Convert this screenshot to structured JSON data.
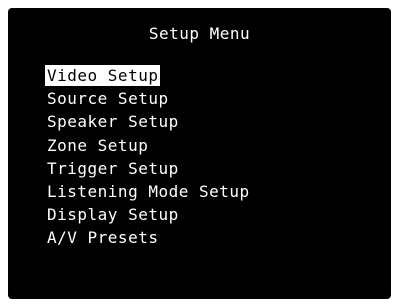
{
  "title": "Setup Menu",
  "selected_index": 0,
  "menu_items": [
    "Video Setup",
    "Source Setup",
    "Speaker Setup",
    "Zone Setup",
    "Trigger Setup",
    "Listening Mode Setup",
    "Display Setup",
    "A/V Presets"
  ],
  "colors": {
    "background": "#000000",
    "text": "#ffffff",
    "highlight_bg": "#ffffff",
    "highlight_text": "#000000"
  }
}
